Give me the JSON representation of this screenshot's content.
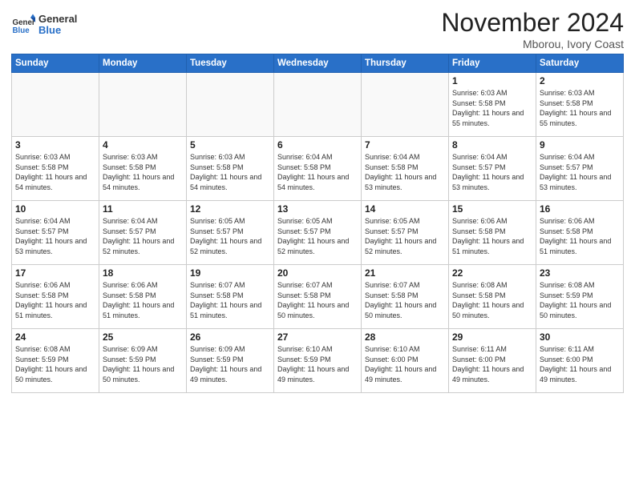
{
  "header": {
    "logo_general": "General",
    "logo_blue": "Blue",
    "month_title": "November 2024",
    "location": "Mborou, Ivory Coast"
  },
  "weekdays": [
    "Sunday",
    "Monday",
    "Tuesday",
    "Wednesday",
    "Thursday",
    "Friday",
    "Saturday"
  ],
  "weeks": [
    [
      {
        "day": "",
        "info": ""
      },
      {
        "day": "",
        "info": ""
      },
      {
        "day": "",
        "info": ""
      },
      {
        "day": "",
        "info": ""
      },
      {
        "day": "",
        "info": ""
      },
      {
        "day": "1",
        "info": "Sunrise: 6:03 AM\nSunset: 5:58 PM\nDaylight: 11 hours and 55 minutes."
      },
      {
        "day": "2",
        "info": "Sunrise: 6:03 AM\nSunset: 5:58 PM\nDaylight: 11 hours and 55 minutes."
      }
    ],
    [
      {
        "day": "3",
        "info": "Sunrise: 6:03 AM\nSunset: 5:58 PM\nDaylight: 11 hours and 54 minutes."
      },
      {
        "day": "4",
        "info": "Sunrise: 6:03 AM\nSunset: 5:58 PM\nDaylight: 11 hours and 54 minutes."
      },
      {
        "day": "5",
        "info": "Sunrise: 6:03 AM\nSunset: 5:58 PM\nDaylight: 11 hours and 54 minutes."
      },
      {
        "day": "6",
        "info": "Sunrise: 6:04 AM\nSunset: 5:58 PM\nDaylight: 11 hours and 54 minutes."
      },
      {
        "day": "7",
        "info": "Sunrise: 6:04 AM\nSunset: 5:58 PM\nDaylight: 11 hours and 53 minutes."
      },
      {
        "day": "8",
        "info": "Sunrise: 6:04 AM\nSunset: 5:57 PM\nDaylight: 11 hours and 53 minutes."
      },
      {
        "day": "9",
        "info": "Sunrise: 6:04 AM\nSunset: 5:57 PM\nDaylight: 11 hours and 53 minutes."
      }
    ],
    [
      {
        "day": "10",
        "info": "Sunrise: 6:04 AM\nSunset: 5:57 PM\nDaylight: 11 hours and 53 minutes."
      },
      {
        "day": "11",
        "info": "Sunrise: 6:04 AM\nSunset: 5:57 PM\nDaylight: 11 hours and 52 minutes."
      },
      {
        "day": "12",
        "info": "Sunrise: 6:05 AM\nSunset: 5:57 PM\nDaylight: 11 hours and 52 minutes."
      },
      {
        "day": "13",
        "info": "Sunrise: 6:05 AM\nSunset: 5:57 PM\nDaylight: 11 hours and 52 minutes."
      },
      {
        "day": "14",
        "info": "Sunrise: 6:05 AM\nSunset: 5:57 PM\nDaylight: 11 hours and 52 minutes."
      },
      {
        "day": "15",
        "info": "Sunrise: 6:06 AM\nSunset: 5:58 PM\nDaylight: 11 hours and 51 minutes."
      },
      {
        "day": "16",
        "info": "Sunrise: 6:06 AM\nSunset: 5:58 PM\nDaylight: 11 hours and 51 minutes."
      }
    ],
    [
      {
        "day": "17",
        "info": "Sunrise: 6:06 AM\nSunset: 5:58 PM\nDaylight: 11 hours and 51 minutes."
      },
      {
        "day": "18",
        "info": "Sunrise: 6:06 AM\nSunset: 5:58 PM\nDaylight: 11 hours and 51 minutes."
      },
      {
        "day": "19",
        "info": "Sunrise: 6:07 AM\nSunset: 5:58 PM\nDaylight: 11 hours and 51 minutes."
      },
      {
        "day": "20",
        "info": "Sunrise: 6:07 AM\nSunset: 5:58 PM\nDaylight: 11 hours and 50 minutes."
      },
      {
        "day": "21",
        "info": "Sunrise: 6:07 AM\nSunset: 5:58 PM\nDaylight: 11 hours and 50 minutes."
      },
      {
        "day": "22",
        "info": "Sunrise: 6:08 AM\nSunset: 5:58 PM\nDaylight: 11 hours and 50 minutes."
      },
      {
        "day": "23",
        "info": "Sunrise: 6:08 AM\nSunset: 5:59 PM\nDaylight: 11 hours and 50 minutes."
      }
    ],
    [
      {
        "day": "24",
        "info": "Sunrise: 6:08 AM\nSunset: 5:59 PM\nDaylight: 11 hours and 50 minutes."
      },
      {
        "day": "25",
        "info": "Sunrise: 6:09 AM\nSunset: 5:59 PM\nDaylight: 11 hours and 50 minutes."
      },
      {
        "day": "26",
        "info": "Sunrise: 6:09 AM\nSunset: 5:59 PM\nDaylight: 11 hours and 49 minutes."
      },
      {
        "day": "27",
        "info": "Sunrise: 6:10 AM\nSunset: 5:59 PM\nDaylight: 11 hours and 49 minutes."
      },
      {
        "day": "28",
        "info": "Sunrise: 6:10 AM\nSunset: 6:00 PM\nDaylight: 11 hours and 49 minutes."
      },
      {
        "day": "29",
        "info": "Sunrise: 6:11 AM\nSunset: 6:00 PM\nDaylight: 11 hours and 49 minutes."
      },
      {
        "day": "30",
        "info": "Sunrise: 6:11 AM\nSunset: 6:00 PM\nDaylight: 11 hours and 49 minutes."
      }
    ]
  ]
}
